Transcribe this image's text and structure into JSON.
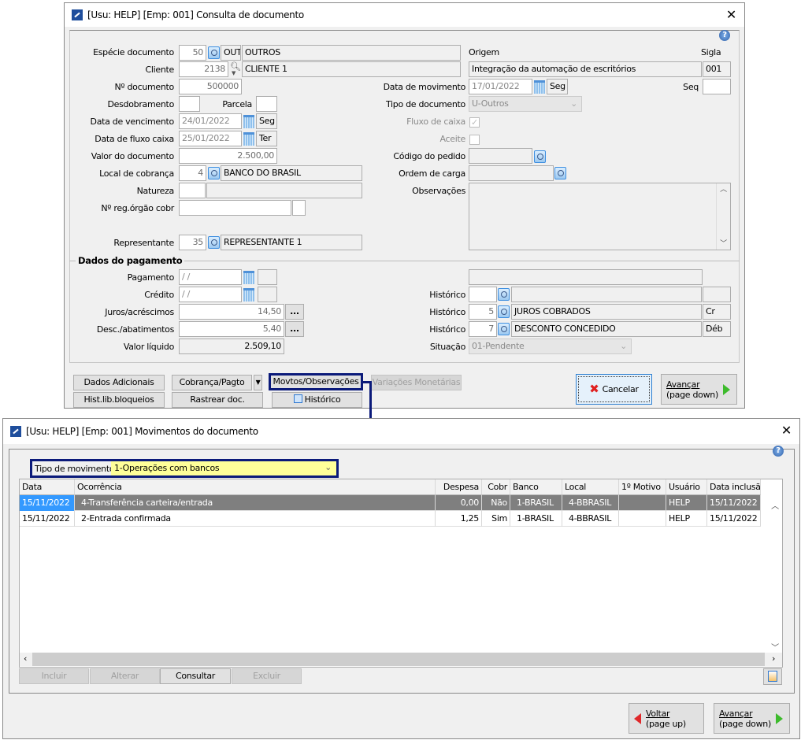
{
  "doc_window": {
    "title": "[Usu: HELP] [Emp: 001] Consulta de documento",
    "help_icon": "?",
    "fields": {
      "especie": {
        "label": "Espécie documento",
        "code": "50",
        "sigla": "OUT",
        "desc": "OUTROS"
      },
      "cliente": {
        "label": "Cliente",
        "code": "2138",
        "desc": "CLIENTE 1"
      },
      "num_doc": {
        "label": "Nº documento",
        "value": "500000"
      },
      "desdobramento": {
        "label": "Desdobramento",
        "value": ""
      },
      "parcela": {
        "label": "Parcela",
        "value": ""
      },
      "vencimento": {
        "label": "Data de vencimento",
        "value": "24/01/2022",
        "day": "Seg"
      },
      "fluxo": {
        "label": "Data de fluxo caixa",
        "value": "25/01/2022",
        "day": "Ter"
      },
      "valor": {
        "label": "Valor do documento",
        "value": "2.500,00"
      },
      "local_cobranca": {
        "label": "Local de cobrança",
        "code": "4",
        "desc": "BANCO DO BRASIL"
      },
      "natureza": {
        "label": "Natureza",
        "code": "",
        "desc": ""
      },
      "reg_orgao": {
        "label": "Nº reg.órgão cobr",
        "value": ""
      },
      "representante": {
        "label": "Representante",
        "code": "35",
        "desc": "REPRESENTANTE 1"
      },
      "origem": {
        "label": "Origem",
        "value": "Integração da automação de escritórios"
      },
      "sigla": {
        "label": "Sigla",
        "value": "001"
      },
      "data_mov": {
        "label": "Data de movimento",
        "value": "17/01/2022",
        "day": "Seg"
      },
      "seq": {
        "label": "Seq",
        "value": ""
      },
      "tipo_doc": {
        "label": "Tipo de documento",
        "value": "U-Outros"
      },
      "fluxo_caixa": {
        "label": "Fluxo de caixa",
        "checked": true
      },
      "aceite": {
        "label": "Aceite",
        "checked": false
      },
      "cod_pedido": {
        "label": "Código do pedido",
        "value": ""
      },
      "ordem_carga": {
        "label": "Ordem de carga",
        "value": ""
      },
      "observacoes": {
        "label": "Observações",
        "value": ""
      }
    },
    "pagamento": {
      "section": "Dados do pagamento",
      "pagamento": {
        "label": "Pagamento",
        "value": " / /"
      },
      "credito": {
        "label": "Crédito",
        "value": " / /"
      },
      "juros": {
        "label": "Juros/acréscimos",
        "value": "14,50"
      },
      "desc": {
        "label": "Desc./abatimentos",
        "value": "5,40"
      },
      "liquido": {
        "label": "Valor líquido",
        "value": "2.509,10"
      },
      "ellipsis": "...",
      "historicos": [
        {
          "label": "Histórico",
          "code": "",
          "desc": "",
          "type": ""
        },
        {
          "label": "Histórico",
          "code": "5",
          "desc": "JUROS COBRADOS",
          "type": "Cr"
        },
        {
          "label": "Histórico",
          "code": "7",
          "desc": "DESCONTO CONCEDIDO",
          "type": "Déb"
        }
      ],
      "situacao": {
        "label": "Situação",
        "value": "01-Pendente"
      }
    },
    "buttons": {
      "dados_adicionais": "Dados Adicionais",
      "hist_lib": "Hist.lib.bloqueios",
      "cobranca": "Cobrança/Pagto",
      "rastrear": "Rastrear doc.",
      "movtos": "Movtos/Observações",
      "variacoes": "Variações Monetárias",
      "historico": "Histórico",
      "cancelar": "Cancelar",
      "avancar": "Avançar",
      "avancar_sub": "(page down)"
    }
  },
  "mov_window": {
    "title": "[Usu: HELP] [Emp: 001] Movimentos do documento",
    "help_icon": "?",
    "tipo_movimento": {
      "label": "Tipo de movimento",
      "value": "1-Operações com bancos"
    },
    "columns": [
      "Data",
      "Ocorrência",
      "Despesa",
      "Cobr",
      "Banco",
      "Local",
      "1º Motivo",
      "Usuário",
      "Data inclusão"
    ],
    "rows": [
      [
        "15/11/2022",
        "4-Transferência carteira/entrada",
        "0,00",
        "Não",
        "1-BRASIL",
        "4-BBRASIL",
        "",
        "HELP",
        "15/11/2022"
      ],
      [
        "15/11/2022",
        "2-Entrada confirmada",
        "1,25",
        "Sim",
        "1-BRASIL",
        "4-BBRASIL",
        "",
        "HELP",
        "15/11/2022"
      ]
    ],
    "selected_row": 0,
    "buttons": {
      "incluir": "Incluir",
      "alterar": "Alterar",
      "consultar": "Consultar",
      "excluir": "Excluir",
      "voltar": "Voltar",
      "voltar_sub": "(page up)",
      "avancar": "Avançar",
      "avancar_sub": "(page down)"
    },
    "highlight_color": "#0b1a7a"
  }
}
